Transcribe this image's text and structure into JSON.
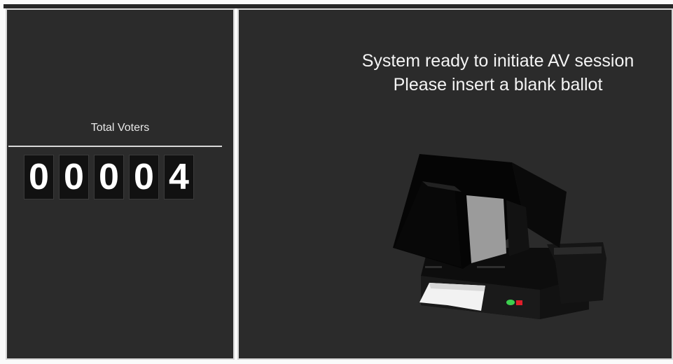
{
  "counter": {
    "label": "Total Voters",
    "digits": [
      "0",
      "0",
      "0",
      "0",
      "4"
    ]
  },
  "status": {
    "line1": "System ready to initiate AV session",
    "line2": "Please insert a blank ballot"
  },
  "colors": {
    "panel_bg": "#2b2b2b",
    "panel_border": "#d7d7d7",
    "digit_bg": "#111111",
    "text": "#f4f4f4",
    "status_green": "#3ccf4e",
    "status_red": "#e01e2a"
  },
  "icons": {
    "machine": "ballot-scanner-machine-icon"
  }
}
